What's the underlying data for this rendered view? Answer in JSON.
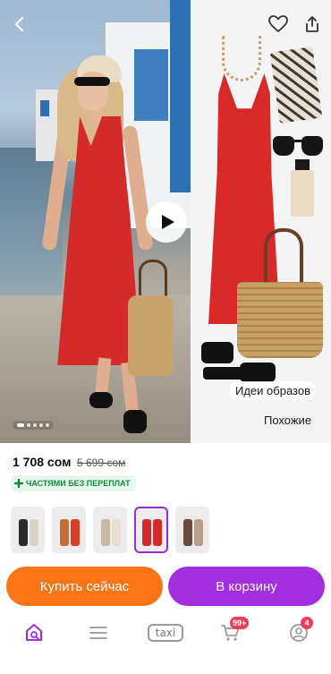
{
  "product": {
    "price": "1 708 сом",
    "old_price": "5 699 сом",
    "installment_label": "ЧАСТЯМИ БЕЗ ПЕРЕПЛАТ"
  },
  "gallery": {
    "outfit_ideas_label": "Идеи образов",
    "similar_label": "Похожие",
    "slide_count": 5,
    "active_slide": 1
  },
  "variants": [
    {
      "colors": [
        "#2a2a2a",
        "#d8d2c8"
      ],
      "selected": false
    },
    {
      "colors": [
        "#c86a3a",
        "#d8402a"
      ],
      "selected": false
    },
    {
      "colors": [
        "#c9b8a4",
        "#e7ddd0"
      ],
      "selected": false
    },
    {
      "colors": [
        "#d52a2a",
        "#d52a2a"
      ],
      "selected": true
    },
    {
      "colors": [
        "#6a4a3a",
        "#b7a08a"
      ],
      "selected": false
    }
  ],
  "actions": {
    "buy_now": "Купить сейчас",
    "add_to_cart": "В корзину"
  },
  "nav": {
    "taxi_label": "taxi",
    "cart_badge": "99+",
    "profile_badge": "4"
  },
  "colors": {
    "accent_purple": "#a32ee0",
    "buy_orange": "#fb7416",
    "installment_green": "#14893c",
    "badge_red": "#f23a5a"
  },
  "icons": [
    "back-arrow-icon",
    "heart-icon",
    "share-icon",
    "play-icon",
    "home-search-icon",
    "menu-icon",
    "cart-icon",
    "profile-icon"
  ]
}
